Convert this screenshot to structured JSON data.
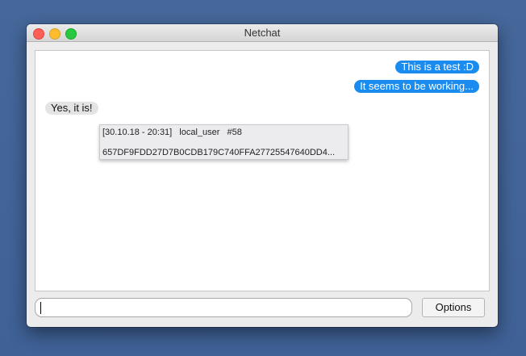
{
  "window": {
    "title": "Netchat"
  },
  "messages": [
    {
      "text": "This is a test :D",
      "sender": "me"
    },
    {
      "text": "It seems to be working...",
      "sender": "me"
    },
    {
      "text": "Yes, it is!",
      "sender": "them"
    }
  ],
  "tooltip": {
    "timestamp": "[30.10.18 - 20:31]",
    "user": "local_user",
    "number": "#58",
    "hash": "657DF9FDD27D7B0CDB179C740FFA27725547640DD4..."
  },
  "composer": {
    "value": "",
    "placeholder": ""
  },
  "buttons": {
    "options_label": "Options"
  },
  "colors": {
    "outgoing": "#1a8cf0",
    "incoming": "#e4e4e4",
    "desktop": "#45679a"
  }
}
